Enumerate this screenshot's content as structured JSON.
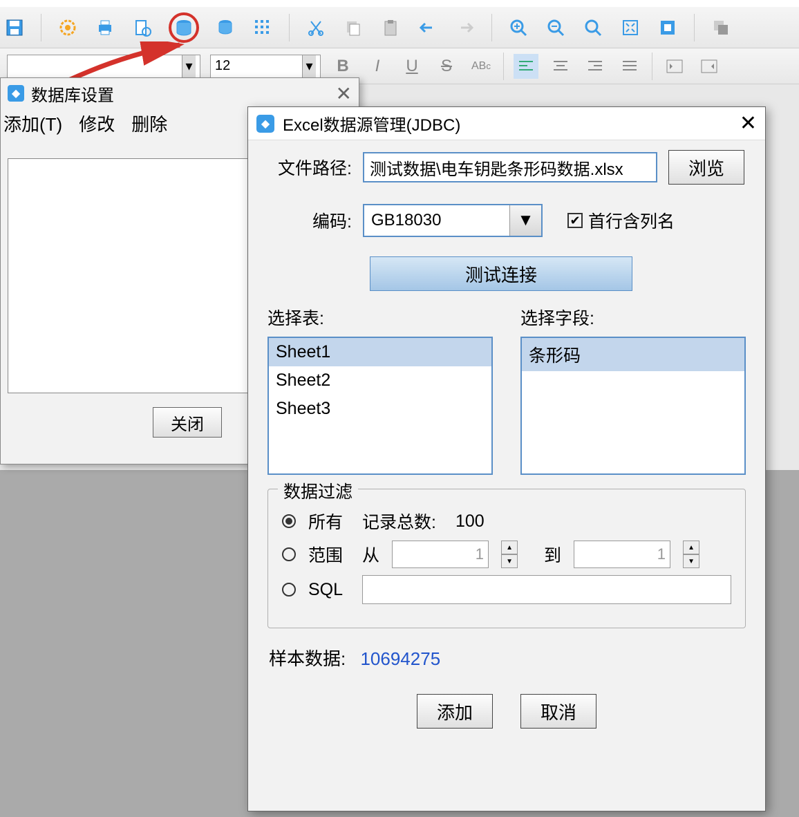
{
  "font": {
    "size": "12"
  },
  "dlg1": {
    "title": "数据库设置",
    "menu": {
      "add": "添加(T)",
      "edit": "修改",
      "delete": "删除"
    },
    "close": "关闭"
  },
  "dlg2": {
    "title": "Excel数据源管理(JDBC)",
    "pathLabel": "文件路径:",
    "pathValue": "测试数据\\电车钥匙条形码数据.xlsx",
    "browse": "浏览",
    "encodingLabel": "编码:",
    "encodingValue": "GB18030",
    "firstRowHeader": "首行含列名",
    "testConn": "测试连接",
    "selectTable": "选择表:",
    "tables": [
      "Sheet1",
      "Sheet2",
      "Sheet3"
    ],
    "selectField": "选择字段:",
    "fields": [
      "条形码"
    ],
    "filterTitle": "数据过滤",
    "filter": {
      "all": "所有",
      "range": "范围",
      "sql": "SQL",
      "recordCount": "记录总数:",
      "recordCountVal": "100",
      "from": "从",
      "fromVal": "1",
      "to": "到",
      "toVal": "1"
    },
    "sampleLabel": "样本数据:",
    "sampleValue": "10694275",
    "add": "添加",
    "cancel": "取消"
  }
}
